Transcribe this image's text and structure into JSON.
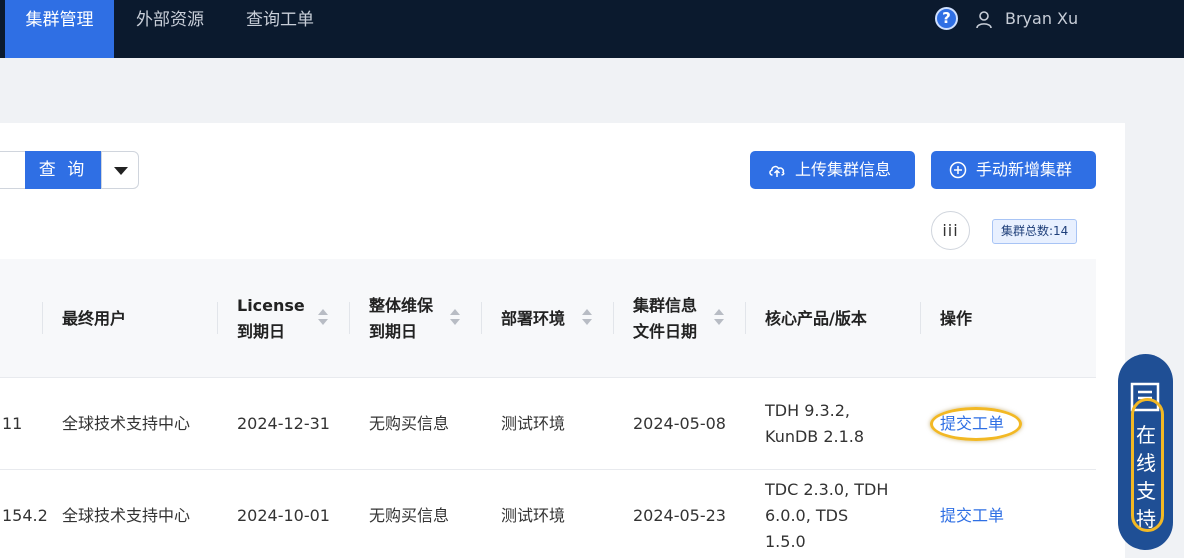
{
  "nav": {
    "tabs": [
      {
        "label": "集群管理",
        "active": true
      },
      {
        "label": "外部资源",
        "active": false
      },
      {
        "label": "查询工单",
        "active": false
      }
    ],
    "help_symbol": "?",
    "user_name": "Bryan Xu"
  },
  "toolbar": {
    "search_label": "查 询",
    "upload_label": "上传集群信息",
    "add_label": "手动新增集群",
    "columns_label": "iii",
    "total_label": "集群总数:14"
  },
  "table": {
    "headers": [
      "最终用户",
      "License\n到期日",
      "整体维保\n到期日",
      "部署环境",
      "集群信息\n文件日期",
      "核心产品/版本",
      "操作"
    ],
    "rows": [
      {
        "id_suffix": "11",
        "end_user": "全球技术支持中心",
        "license_expiry": "2024-12-31",
        "maintenance": "无购买信息",
        "env": "测试环境",
        "file_date": "2024-05-08",
        "products": "TDH 9.3.2, KunDB 2.1.8",
        "action": "提交工单"
      },
      {
        "id_suffix": "154.2",
        "end_user": "全球技术支持中心",
        "license_expiry": "2024-10-01",
        "maintenance": "无购买信息",
        "env": "测试环境",
        "file_date": "2024-05-23",
        "products": "TDC 2.3.0, TDH 6.0.0, TDS 1.5.0",
        "action": "提交工单"
      }
    ]
  },
  "support": {
    "label": "在线支持"
  },
  "colors": {
    "nav_bg": "#0b1a2e",
    "accent": "#2f6fe4",
    "highlight": "#f2b824",
    "support_bg": "#1f4f95"
  }
}
